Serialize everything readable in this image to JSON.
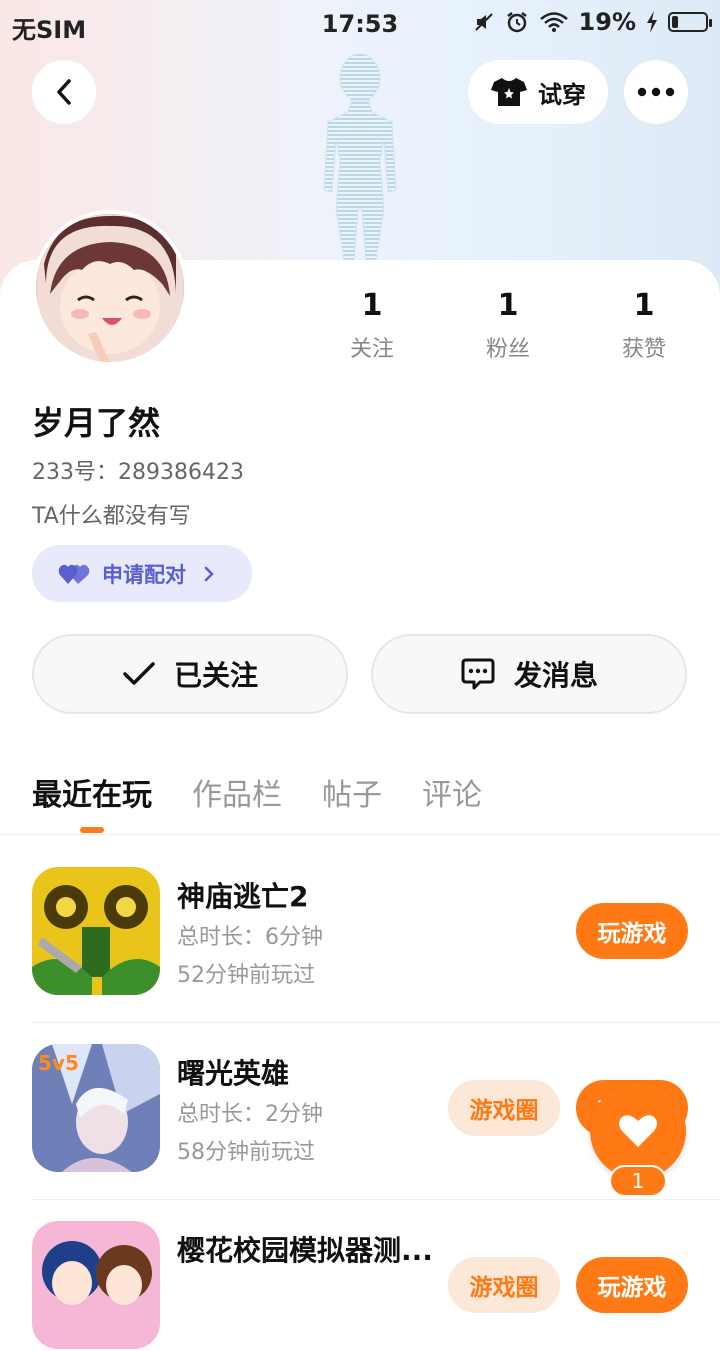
{
  "status_bar": {
    "carrier": "无SIM",
    "time": "17:53",
    "battery_percent": "19%",
    "battery_level": 0.19,
    "icons": [
      "mute-icon",
      "alarm-icon",
      "wifi-icon",
      "charging-icon",
      "battery-icon"
    ]
  },
  "header": {
    "back_icon": "chevron-left-icon",
    "try_on_label": "试穿",
    "try_on_icon": "shirt-icon",
    "more_icon": "more-dots-icon"
  },
  "profile": {
    "username": "岁月了然",
    "uid": "233号：289386423",
    "bio": "TA什么都没有写",
    "stats": [
      {
        "value": "1",
        "label": "关注"
      },
      {
        "value": "1",
        "label": "粉丝"
      },
      {
        "value": "1",
        "label": "获赞"
      }
    ],
    "pair_label": "申请配对"
  },
  "actions": {
    "follow_label": "已关注",
    "message_label": "发消息"
  },
  "tabs": [
    {
      "label": "最近在玩",
      "active": true
    },
    {
      "label": "作品栏",
      "active": false
    },
    {
      "label": "帖子",
      "active": false
    },
    {
      "label": "评论",
      "active": false
    }
  ],
  "games": [
    {
      "name": "神庙逃亡2",
      "duration": "总时长：6分钟",
      "last_played": "52分钟前玩过",
      "play_label": "玩游戏"
    },
    {
      "name": "曙光英雄",
      "duration": "总时长：2分钟",
      "last_played": "58分钟前玩过",
      "circle_label": "游戏圈",
      "play_label": "玩游戏"
    },
    {
      "name": "樱花校园模拟器测...",
      "duration": "",
      "last_played": "",
      "circle_label": "游戏圈",
      "play_label": "玩游戏"
    }
  ],
  "like_fab": {
    "count": "1"
  },
  "colors": {
    "accent": "#ff7a14",
    "pair_text": "#5a5fcf",
    "pair_bg": "#e8e9fb"
  }
}
